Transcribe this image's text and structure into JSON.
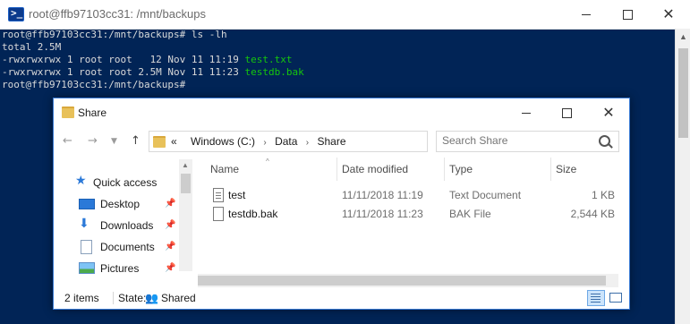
{
  "terminal": {
    "title": "root@ffb97103cc31: /mnt/backups",
    "lines": [
      {
        "prompt": "root@ffb97103cc31:/mnt/backups# ",
        "command": "ls -lh"
      },
      {
        "text": "total 2.5M"
      },
      {
        "meta": "-rwxrwxrwx 1 root root   12 Nov 11 11:19 ",
        "file": "test.txt"
      },
      {
        "meta": "-rwxrwxrwx 1 root root 2.5M Nov 11 11:23 ",
        "file": "testdb.bak"
      },
      {
        "prompt": "root@ffb97103cc31:/mnt/backups# "
      }
    ],
    "colors": {
      "background": "#012456",
      "text": "#d9d9d9",
      "file_highlight": "#16c60c"
    }
  },
  "explorer": {
    "title": "Share",
    "breadcrumb": {
      "overflow": "«",
      "segments": [
        "Windows (C:)",
        "Data",
        "Share"
      ]
    },
    "search": {
      "placeholder": "Search Share"
    },
    "nav": {
      "items": [
        {
          "label": "Quick access",
          "icon": "star-icon",
          "pinned": false
        },
        {
          "label": "Desktop",
          "icon": "desktop-icon",
          "pinned": true
        },
        {
          "label": "Downloads",
          "icon": "download-icon",
          "pinned": true
        },
        {
          "label": "Documents",
          "icon": "documents-icon",
          "pinned": true
        },
        {
          "label": "Pictures",
          "icon": "pictures-icon",
          "pinned": true
        }
      ]
    },
    "columns": [
      "Name",
      "Date modified",
      "Type",
      "Size"
    ],
    "files": [
      {
        "name": "test",
        "date": "11/11/2018 11:19",
        "type": "Text Document",
        "size": "1 KB",
        "icon": "text-file-icon"
      },
      {
        "name": "testdb.bak",
        "date": "11/11/2018 11:23",
        "type": "BAK File",
        "size": "2,544 KB",
        "icon": "file-icon"
      }
    ],
    "status": {
      "count": "2 items",
      "state_label": "State:",
      "state_value": "Shared"
    }
  }
}
